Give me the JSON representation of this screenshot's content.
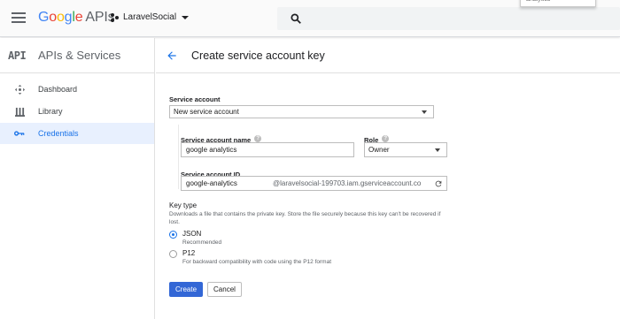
{
  "topbar": {
    "logo": {
      "letters": [
        "G",
        "o",
        "o",
        "g",
        "l",
        "e"
      ],
      "suffix": "APIs"
    },
    "project_name": "LaravelSocial",
    "dropdown_stub": "analytics"
  },
  "sidebar": {
    "badge": "API",
    "title": "APIs & Services",
    "items": [
      {
        "label": "Dashboard",
        "icon": "dashboard-icon",
        "active": false
      },
      {
        "label": "Library",
        "icon": "library-icon",
        "active": false
      },
      {
        "label": "Credentials",
        "icon": "key-icon",
        "active": true
      }
    ]
  },
  "main": {
    "title": "Create service account key",
    "form": {
      "service_account_label": "Service account",
      "service_account_value": "New service account",
      "name_label": "Service account name",
      "name_value": "google analytics",
      "role_label": "Role",
      "role_value": "Owner",
      "id_label": "Service account ID",
      "id_value": "google-analytics",
      "id_suffix": "@laravelsocial-199703.iam.gserviceaccount.co",
      "key_type_label": "Key type",
      "key_type_desc": "Downloads a file that contains the private key. Store the file securely because this key can't be recovered if lost.",
      "options": [
        {
          "label": "JSON",
          "sub": "Recommended",
          "selected": true
        },
        {
          "label": "P12",
          "sub": "For backward compatibility with code using the P12 format",
          "selected": false
        }
      ],
      "create_label": "Create",
      "cancel_label": "Cancel"
    }
  },
  "colors": {
    "accent": "#1a73e8",
    "primary_button": "#3367d6",
    "active_nav_bg": "#e8f0fe"
  }
}
